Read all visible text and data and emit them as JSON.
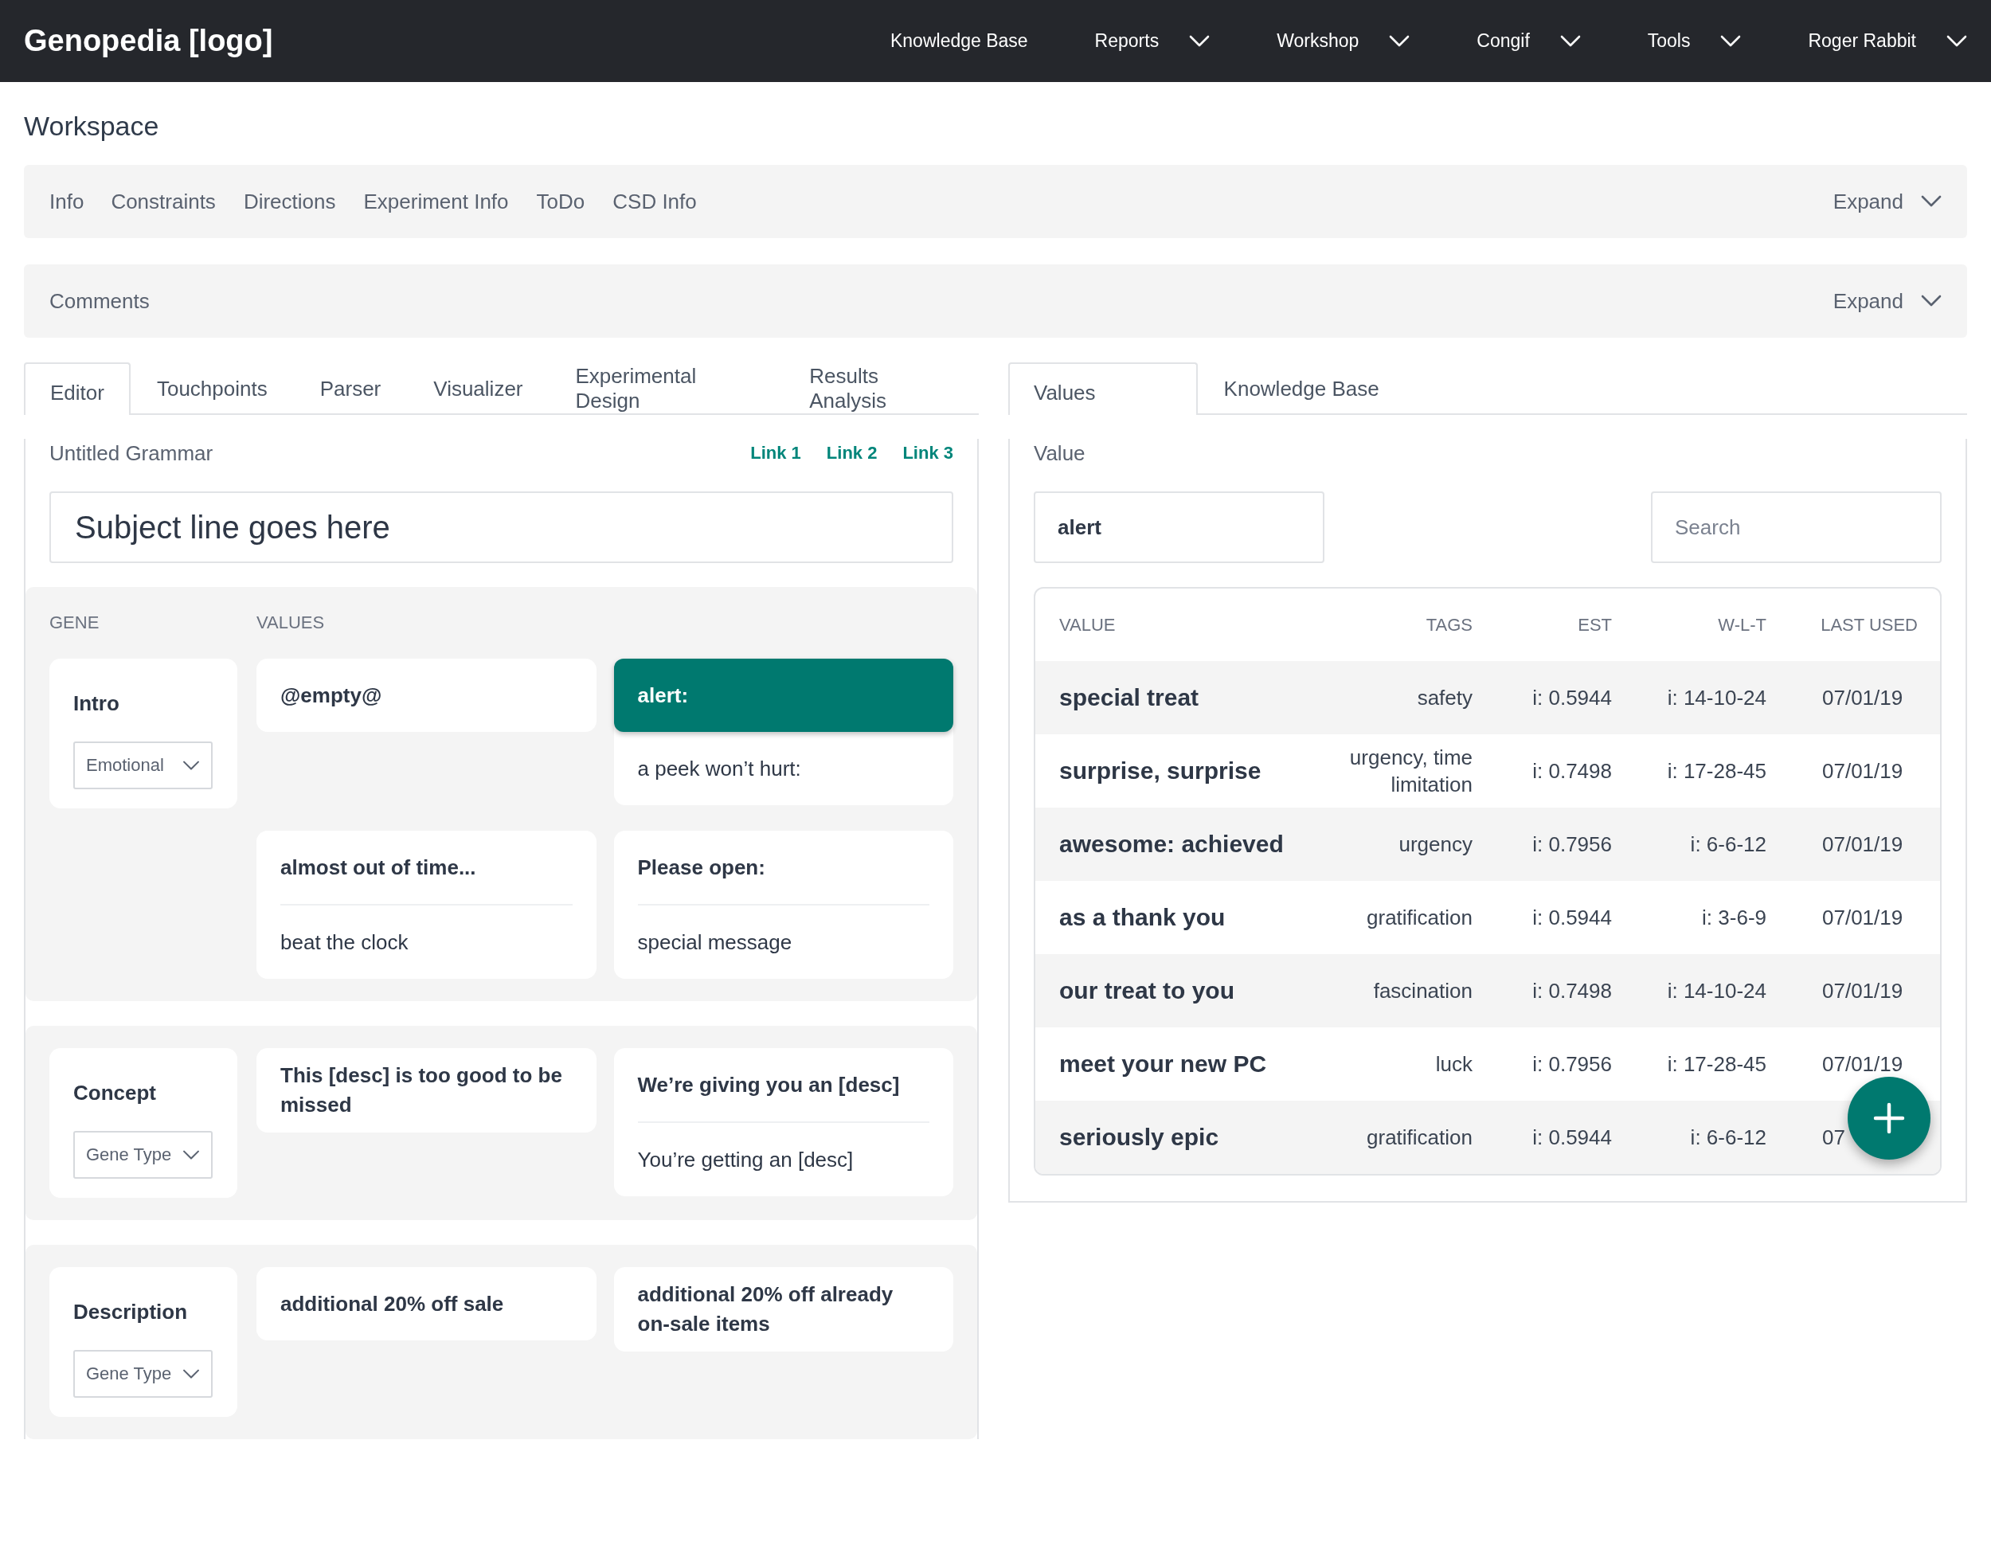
{
  "top_bar": {
    "brand": "Genopedia [logo]",
    "menu": [
      {
        "label": "Knowledge Base",
        "dropdown": false
      },
      {
        "label": "Reports",
        "dropdown": true
      },
      {
        "label": "Workshop",
        "dropdown": true
      },
      {
        "label": "Congif",
        "dropdown": true
      },
      {
        "label": "Tools",
        "dropdown": true
      },
      {
        "label": "Roger Rabbit",
        "dropdown": true
      }
    ]
  },
  "page_title": "Workspace",
  "info_bar": {
    "tabs": [
      "Info",
      "Constraints",
      "Directions",
      "Experiment Info",
      "ToDo",
      "CSD Info"
    ],
    "toggle": "Expand"
  },
  "comments_bar": {
    "title": "Comments",
    "toggle": "Expand"
  },
  "editor": {
    "tabs": [
      {
        "label": "Editor",
        "selected": true
      },
      {
        "label": "Touchpoints",
        "selected": false
      },
      {
        "label": "Parser",
        "selected": false
      },
      {
        "label": "Visualizer",
        "selected": false
      },
      {
        "label": "Experimental Design",
        "selected": false
      },
      {
        "label": "Results Analysis",
        "selected": false
      }
    ],
    "grammar_title": "Untitled Grammar",
    "links": [
      "Link 1",
      "Link 2",
      "Link 3"
    ],
    "subject": "Subject line goes here",
    "columns": [
      "GENE",
      "VALUES"
    ],
    "genes": [
      {
        "name": "Intro",
        "gene_type": "Emotional",
        "values": [
          {
            "options": [
              {
                "text": "@empty@",
                "kind": "primary",
                "selected": false
              }
            ]
          },
          {
            "options": [
              {
                "text": "alert:",
                "kind": "primary",
                "selected": true
              },
              {
                "text": "a peek won’t hurt:",
                "kind": "alternate",
                "selected": false
              }
            ]
          },
          {
            "options": [
              {
                "text": "almost out of time...",
                "kind": "primary",
                "selected": false
              },
              {
                "text": "beat the clock",
                "kind": "alternate",
                "selected": false
              }
            ]
          },
          {
            "options": [
              {
                "text": "Please open:",
                "kind": "primary",
                "selected": false
              },
              {
                "text": "special message",
                "kind": "alternate",
                "selected": false
              }
            ]
          }
        ]
      },
      {
        "name": "Concept",
        "gene_type": "Gene Type",
        "values": [
          {
            "options": [
              {
                "text": "This [desc] is too good to be missed",
                "kind": "primary",
                "selected": false
              }
            ]
          },
          {
            "options": [
              {
                "text": "We’re giving you an [desc]",
                "kind": "primary",
                "selected": false
              },
              {
                "text": "You’re getting an [desc]",
                "kind": "alternate",
                "selected": false
              }
            ]
          }
        ]
      },
      {
        "name": "Description",
        "gene_type": "Gene Type",
        "values": [
          {
            "options": [
              {
                "text": "additional 20% off sale",
                "kind": "primary",
                "selected": false
              }
            ]
          },
          {
            "options": [
              {
                "text": "additional 20% off already on-sale items",
                "kind": "primary",
                "selected": false
              }
            ]
          }
        ]
      }
    ]
  },
  "values_panel": {
    "tabs": [
      {
        "label": "Values",
        "selected": true
      },
      {
        "label": "Knowledge Base",
        "selected": false
      }
    ],
    "label": "Value",
    "value_field": "alert",
    "search": {
      "placeholder": "Search"
    },
    "table": {
      "columns": [
        "VALUE",
        "TAGS",
        "EST",
        "W-L-T",
        "LAST USED"
      ],
      "rows": [
        {
          "value": "special treat",
          "tags": "safety",
          "est": "i: 0.5944",
          "wlt": "i: 14-10-24",
          "last_used": "07/01/19"
        },
        {
          "value": "surprise, surprise",
          "tags": "urgency, time limitation",
          "est": "i: 0.7498",
          "wlt": "i: 17-28-45",
          "last_used": "07/01/19"
        },
        {
          "value": "awesome: achieved",
          "tags": "urgency",
          "est": "i: 0.7956",
          "wlt": "i: 6-6-12",
          "last_used": "07/01/19"
        },
        {
          "value": "as a thank you",
          "tags": "gratification",
          "est": "i: 0.5944",
          "wlt": "i: 3-6-9",
          "last_used": "07/01/19"
        },
        {
          "value": "our treat to you",
          "tags": "fascination",
          "est": "i: 0.7498",
          "wlt": "i: 14-10-24",
          "last_used": "07/01/19"
        },
        {
          "value": "meet your new PC",
          "tags": "luck",
          "est": "i: 0.7956",
          "wlt": "i: 17-28-45",
          "last_used": "07/01/19"
        },
        {
          "value": "seriously epic",
          "tags": "gratification",
          "est": "i: 0.5944",
          "wlt": "i: 6-6-12",
          "last_used": "07"
        }
      ]
    }
  }
}
